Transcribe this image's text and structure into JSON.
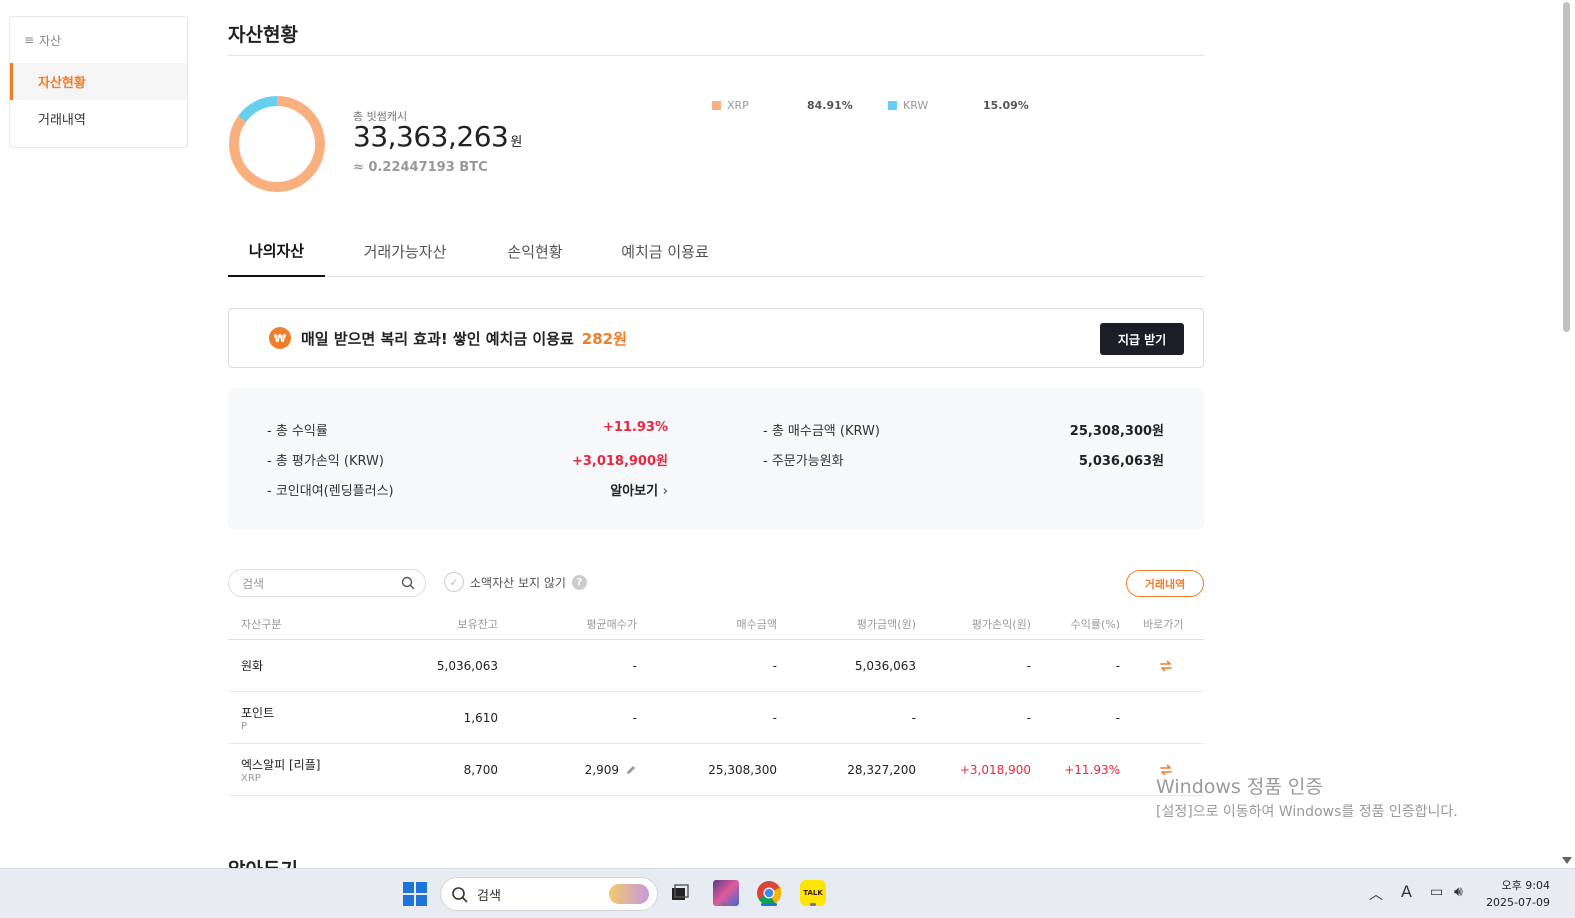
{
  "sidebar": {
    "header": "자산",
    "items": [
      {
        "label": "자산현황",
        "active": true
      },
      {
        "label": "거래내역",
        "active": false
      }
    ]
  },
  "page": {
    "title": "자산현황"
  },
  "summary": {
    "total_label": "총 빗썸캐시",
    "total_value": "33,363,263",
    "total_unit": "원",
    "btc_value": "≈ 0.22447193 BTC",
    "allocation": [
      {
        "name": "XRP",
        "percent_label": "84.91%",
        "fraction": 0.8491,
        "color": "#f9b07e"
      },
      {
        "name": "KRW",
        "percent_label": "15.09%",
        "fraction": 0.1509,
        "color": "#65cff0"
      }
    ]
  },
  "tabs": [
    {
      "label": "나의자산",
      "active": true
    },
    {
      "label": "거래가능자산",
      "active": false
    },
    {
      "label": "손익현황",
      "active": false
    },
    {
      "label": "예치금 이용료",
      "active": false
    }
  ],
  "banner": {
    "icon": "₩",
    "text": "매일 받으면 복리 효과! 쌓인 예치금 이용료",
    "amount": "282원",
    "button": "지급 받기"
  },
  "stats": {
    "total_return_label": "- 총 수익률",
    "total_return_value": "+11.93%",
    "total_pnl_label": "- 총 평가손익 (KRW)",
    "total_pnl_value": "+3,018,900원",
    "lending_label": "- 코인대여(렌딩플러스)",
    "lending_link": "알아보기",
    "total_buy_label": "- 총 매수금액 (KRW)",
    "total_buy_value": "25,308,300원",
    "orderable_label": "- 주문가능원화",
    "orderable_value": "5,036,063원"
  },
  "toolbar": {
    "search_placeholder": "검색",
    "hide_small_label": "소액자산 보지 않기",
    "help": "?",
    "history_button": "거래내역"
  },
  "table": {
    "headers": [
      "자산구분",
      "보유잔고",
      "평균매수가",
      "매수금액",
      "평가금액(원)",
      "평가손익(원)",
      "수익률(%)",
      "바로가기"
    ],
    "rows": [
      {
        "name": "원화",
        "symbol": "",
        "balance": "5,036,063",
        "avg_price": "-",
        "buy_amount": "-",
        "eval_amount": "5,036,063",
        "pnl": "-",
        "rate": "-",
        "shortcut": true,
        "red": false,
        "editable": false
      },
      {
        "name": "포인트",
        "symbol": "P",
        "balance": "1,610",
        "avg_price": "-",
        "buy_amount": "-",
        "eval_amount": "-",
        "pnl": "-",
        "rate": "-",
        "shortcut": false,
        "red": false,
        "editable": false
      },
      {
        "name": "엑스알피 [리플]",
        "symbol": "XRP",
        "balance": "8,700",
        "avg_price": "2,909",
        "buy_amount": "25,308,300",
        "eval_amount": "28,327,200",
        "pnl": "+3,018,900",
        "rate": "+11.93%",
        "shortcut": true,
        "red": true,
        "editable": true
      }
    ]
  },
  "next_section_title": "알아두기",
  "watermark": {
    "line1": "Windows 정품 인증",
    "line2": "[설정]으로 이동하여 Windows를 정품 인증합니다."
  },
  "taskbar": {
    "search_placeholder": "검색",
    "ime": "A",
    "time": "오후 9:04",
    "date": "2025-07-09"
  },
  "colors": {
    "accent": "#f07d2a",
    "red": "#e8283f",
    "dark_button": "#1b1e26"
  }
}
